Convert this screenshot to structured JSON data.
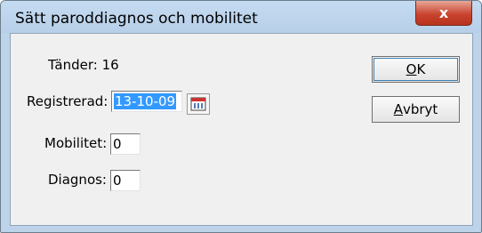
{
  "window": {
    "title": "Sätt paroddiagnos och mobilitet",
    "close_label": "x"
  },
  "form": {
    "teeth_label": "Tänder: 16",
    "registered_label": "Registrerad:",
    "registered_value": "13-10-09",
    "mobility_label": "Mobilitet:",
    "mobility_value": "0",
    "diagnosis_label": "Diagnos:",
    "diagnosis_value": "0"
  },
  "buttons": {
    "ok_mnemonic": "O",
    "ok_rest": "K",
    "cancel_mnemonic": "A",
    "cancel_rest": "vbryt"
  },
  "icons": {
    "calendar": "calendar-icon"
  },
  "colors": {
    "selection": "#3399ff",
    "close": "#c9452f",
    "frame": "#bcd3ea"
  }
}
